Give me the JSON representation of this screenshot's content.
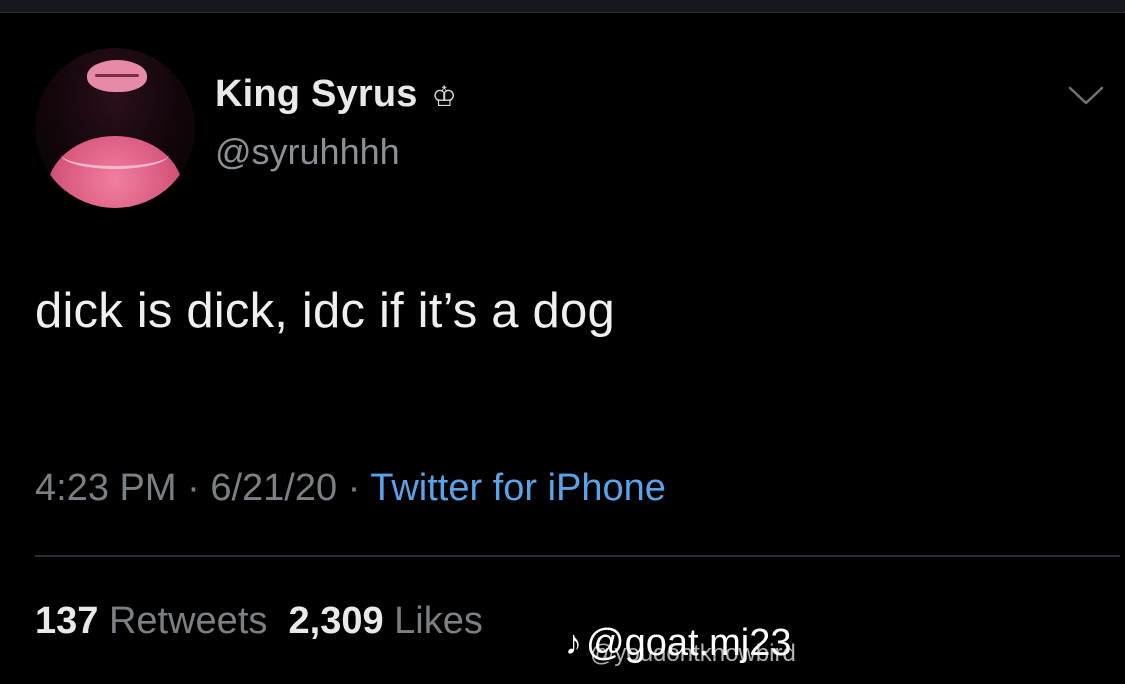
{
  "tweet": {
    "display_name": "King Syrus",
    "crown_icon": "crown-icon",
    "handle": "@syruhhhh",
    "text": "dick is dick, idc if it’s a dog",
    "time": "4:23 PM",
    "separator": "·",
    "date": "6/21/20",
    "source": "Twitter for iPhone",
    "retweets_count": "137",
    "retweets_label": "Retweets",
    "likes_count": "2,309",
    "likes_label": "Likes"
  },
  "watermark": {
    "icon": "music-note-icon",
    "main": "@goat.mj23",
    "sub": "@youdontknowbird"
  },
  "colors": {
    "background": "#000000",
    "text": "#e7e9ea",
    "secondary_text": "#7b8085",
    "link": "#5aa3e8"
  }
}
